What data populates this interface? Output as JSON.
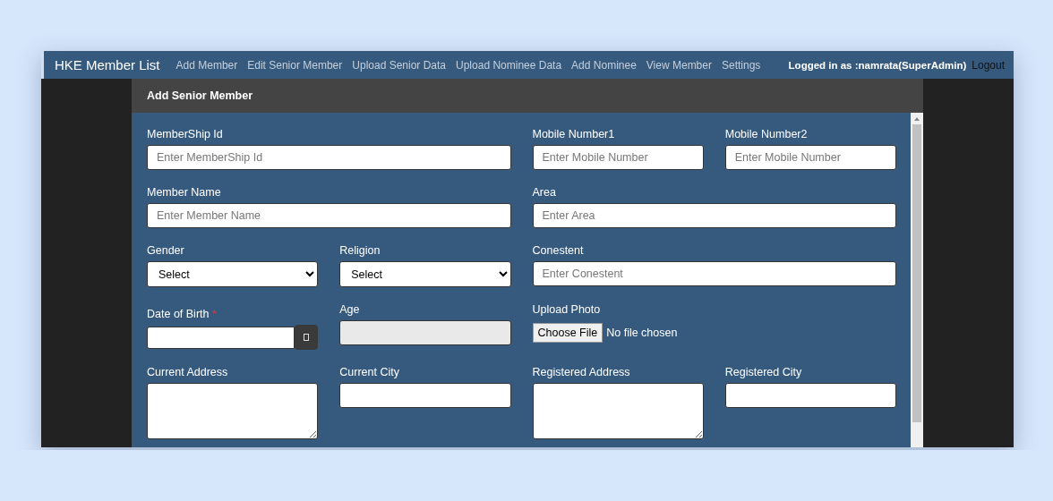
{
  "navbar": {
    "brand": "HKE Member List",
    "links": [
      "Add Member",
      "Edit Senior Member",
      "Upload Senior Data",
      "Upload Nominee Data",
      "Add Nominee",
      "View Member",
      "Settings"
    ],
    "user": "Logged in as :namrata(SuperAdmin)",
    "logout": "Logout"
  },
  "panel": {
    "title": "Add Senior Member"
  },
  "rows": [
    [
      {
        "kind": "text",
        "label": "MemberShip Id",
        "placeholder": "Enter MemberShip Id"
      },
      {
        "kind": "text",
        "label": "Mobile Number1",
        "placeholder": "Enter Mobile Number"
      },
      {
        "kind": "text",
        "label": "Mobile Number2",
        "placeholder": "Enter Mobile Number"
      }
    ],
    [
      {
        "kind": "text",
        "label": "Member Name",
        "placeholder": "Enter Member Name"
      },
      {
        "kind": "text",
        "label": "Area",
        "placeholder": "Enter Area"
      }
    ],
    [
      {
        "kind": "select",
        "label": "Gender",
        "value": "Select"
      },
      {
        "kind": "select",
        "label": "Religion",
        "value": "Select"
      },
      {
        "kind": "text",
        "label": "Conestent",
        "placeholder": "Enter Conestent"
      }
    ],
    [
      {
        "kind": "date",
        "label": "Date of Birth",
        "required": true,
        "required_mark": "*"
      },
      {
        "kind": "readonly",
        "label": "Age"
      },
      {
        "kind": "file",
        "label": "Upload Photo",
        "button": "Choose File",
        "status": "No file chosen"
      }
    ],
    [
      {
        "kind": "textarea",
        "label": "Current Address"
      },
      {
        "kind": "text",
        "label": "Current City"
      },
      {
        "kind": "textarea",
        "label": "Registered Address"
      },
      {
        "kind": "text",
        "label": "Registered City"
      }
    ]
  ]
}
